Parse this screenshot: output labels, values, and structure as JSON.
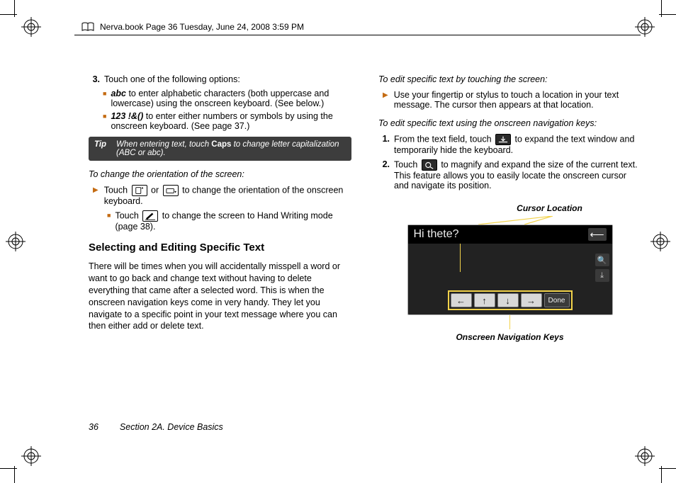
{
  "page_header": {
    "text": "Nerva.book  Page 36  Tuesday, June 24, 2008  3:59 PM"
  },
  "left": {
    "step3_num": "3.",
    "step3": "Touch one of the following options:",
    "abc_label": "abc",
    "abc_text": " to enter alphabetic characters (both uppercase and lowercase) using the onscreen keyboard. (See below.)",
    "num_label": "123 !&()",
    "num_text": " to enter either numbers or symbols by using the onscreen keyboard. (See page 37.)",
    "tip_label": "Tip",
    "tip_text_a": "When entering text, touch ",
    "tip_caps": "Caps",
    "tip_text_b": " to change letter capitalization (ABC or abc).",
    "h_orient": "To change the orientation of the screen:",
    "orient_a": "Touch ",
    "orient_b": " or ",
    "orient_c": " to change the orientation of the onscreen keyboard.",
    "hand_a": "Touch ",
    "hand_b": " to change the screen to Hand Writing mode (page 38).",
    "h2": "Selecting and Editing Specific Text",
    "para": "There will be times when you will accidentally misspell a word or want to go back and change text without having to delete everything that came after a selected word. This is when the onscreen navigation keys come in very handy. They let you navigate to a specific point in your text message where you can then either add or delete text."
  },
  "right": {
    "h_touch": "To edit specific text by touching the screen:",
    "touch_para": "Use your fingertip or stylus to touch a location in your text message. The cursor then appears at that location.",
    "h_nav": "To edit specific text using the onscreen navigation keys:",
    "s1_num": "1.",
    "s1_a": "From the text field, touch ",
    "s1_b": " to expand the text window and temporarily hide the keyboard.",
    "s2_num": "2.",
    "s2_a": "Touch ",
    "s2_b": " to magnify and expand the size of the current text. This feature allows you to easily locate the onscreen cursor and navigate its position.",
    "fig": {
      "cursor_label": "Cursor Location",
      "sample_text": "Hi thete?",
      "done": "Done",
      "nav_label": "Onscreen Navigation Keys"
    }
  },
  "footer": {
    "page": "36",
    "section": "Section 2A. Device Basics"
  }
}
